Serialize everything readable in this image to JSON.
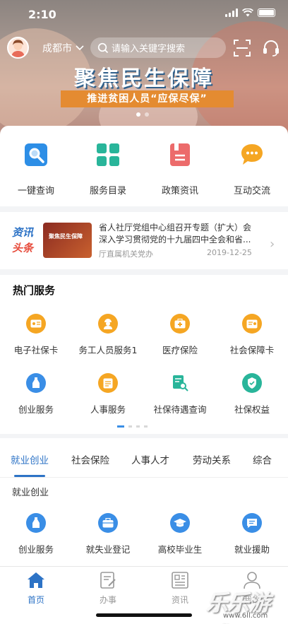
{
  "status": {
    "time": "2:10"
  },
  "header": {
    "city": "成都市",
    "search_placeholder": "请输入关键字搜索"
  },
  "banner": {
    "title": "聚焦民生保障",
    "subtitle": "推进贫困人员“应保尽保”",
    "active_dot": 0
  },
  "quick_actions": [
    {
      "label": "一键查询",
      "icon": "search-icon",
      "color": "#2d8ee6"
    },
    {
      "label": "服务目录",
      "icon": "grid-icon",
      "color": "#29b59a"
    },
    {
      "label": "政策资讯",
      "icon": "document-icon",
      "color": "#ec6b6b"
    },
    {
      "label": "互动交流",
      "icon": "chat-icon",
      "color": "#f5a623"
    }
  ],
  "news": {
    "tag_line1": "资讯",
    "tag_line2": "头条",
    "thumb_text": "聚焦民生保障",
    "title": "省人社厅党组中心组召开专题（扩大）会深入学习贯彻党的十九届四中全会和省...",
    "source": "厅直属机关党办",
    "date": "2019-12-25"
  },
  "hot_services": {
    "title": "热门服务",
    "items": [
      {
        "label": "电子社保卡",
        "icon": "card-icon",
        "color": "#f5a623"
      },
      {
        "label": "务工人员服务1",
        "icon": "worker-icon",
        "color": "#f5a623"
      },
      {
        "label": "医疗保险",
        "icon": "medical-kit-icon",
        "color": "#f5a623"
      },
      {
        "label": "社会保障卡",
        "icon": "id-card-icon",
        "color": "#f5a623"
      },
      {
        "label": "创业服务",
        "icon": "bottle-icon",
        "color": "#3a8ee6"
      },
      {
        "label": "人事服务",
        "icon": "clipboard-icon",
        "color": "#f5a623"
      },
      {
        "label": "社保待遇查询",
        "icon": "search-doc-icon",
        "color": "#29b59a"
      },
      {
        "label": "社保权益",
        "icon": "badge-icon",
        "color": "#29b59a"
      }
    ],
    "pages": 4,
    "active_page": 0
  },
  "tabs": {
    "items": [
      "就业创业",
      "社会保险",
      "人事人才",
      "劳动关系",
      "综合"
    ],
    "active": 0,
    "section_title": "就业创业",
    "services": [
      {
        "label": "创业服务",
        "icon": "bottle-icon",
        "color": "#3a8ee6"
      },
      {
        "label": "就失业登记",
        "icon": "briefcase-icon",
        "color": "#3a8ee6"
      },
      {
        "label": "高校毕业生",
        "icon": "graduation-cap-icon",
        "color": "#3a8ee6"
      },
      {
        "label": "就业援助",
        "icon": "chat-doc-icon",
        "color": "#3a8ee6"
      }
    ]
  },
  "bottom_nav": [
    {
      "label": "首页",
      "icon": "home-icon"
    },
    {
      "label": "办事",
      "icon": "edit-doc-icon"
    },
    {
      "label": "资讯",
      "icon": "newspaper-icon"
    },
    {
      "label": "我的",
      "icon": "user-icon"
    }
  ],
  "bottom_nav_active": 0,
  "watermark": {
    "text": "乐乐游戏",
    "url": "www.6ll.com"
  }
}
